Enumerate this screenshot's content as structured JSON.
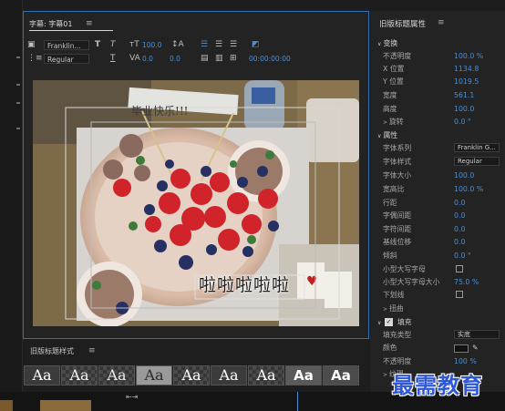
{
  "title_panel": {
    "tab_label": "字幕: 字幕01",
    "menu_glyph": "≡",
    "font_family": "Franklin...",
    "font_style": "Regular",
    "font_size": "100.0",
    "tracking": "0.0",
    "leading": "0.0",
    "timecode": "00:00:00:00",
    "overlay_text": "啦啦啦啦啦",
    "banner_text": "毕业快乐!!!"
  },
  "styles_panel": {
    "label": "旧版标题样式",
    "menu_glyph": "≡",
    "swatches": [
      "Aa",
      "Aa",
      "Aa",
      "Aa",
      "Aa",
      "Aa",
      "Aa",
      "Aa",
      "Aa"
    ]
  },
  "properties": {
    "title": "旧版标题属性",
    "menu_glyph": "≡",
    "transform_section": "变换",
    "opacity_label": "不透明度",
    "opacity_value": "100.0 %",
    "x_label": "X 位置",
    "x_value": "1134.8",
    "y_label": "Y 位置",
    "y_value": "1019.5",
    "width_label": "宽度",
    "width_value": "561.1",
    "height_label": "高度",
    "height_value": "100.0",
    "rotation_label": "旋转",
    "rotation_value": "0.0 °",
    "attrs_section": "属性",
    "font_family_label": "字体系列",
    "font_family_value": "Franklin G...",
    "font_style_label": "字体样式",
    "font_style_value": "Regular",
    "font_size_label": "字体大小",
    "font_size_value": "100.0",
    "aspect_label": "宽高比",
    "aspect_value": "100.0 %",
    "leading_label": "行距",
    "leading_value": "0.0",
    "kerning_label": "字偶间距",
    "kerning_value": "0.0",
    "tracking_label": "字符间距",
    "tracking_value": "0.0",
    "baseline_label": "基线位移",
    "baseline_value": "0.0",
    "slant_label": "倾斜",
    "slant_value": "0.0 °",
    "smallcaps_label": "小型大写字母",
    "smallcaps_size_label": "小型大写字母大小",
    "smallcaps_size_value": "75.0 %",
    "underline_label": "下划线",
    "distort_label": "扭曲",
    "fill_section": "填充",
    "fill_type_label": "填充类型",
    "fill_type_value": "实底",
    "color_label": "颜色",
    "fill_opacity_label": "不透明度",
    "fill_opacity_value": "100 %",
    "texture_label": "纹理"
  },
  "watermark": "最需教育",
  "colors": {
    "accent": "#4c8ed6",
    "panel_border": "#2d6fb5",
    "watermark": "#2f58d8"
  }
}
